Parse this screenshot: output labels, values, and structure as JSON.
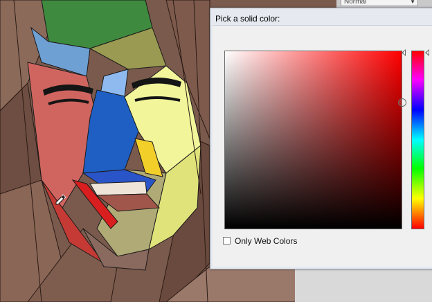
{
  "topbar": {
    "blend_mode_value": "Normal"
  },
  "dialog": {
    "title": "Pick a solid color:",
    "only_web_colors_label": "Only Web Colors",
    "only_web_colors_checked": false
  },
  "colors": {
    "selected_color": "#ff0000",
    "hue_top": "#ff0000"
  },
  "icons": {
    "dropdown": "chevron-down-icon",
    "cursor": "eyedropper-icon"
  }
}
